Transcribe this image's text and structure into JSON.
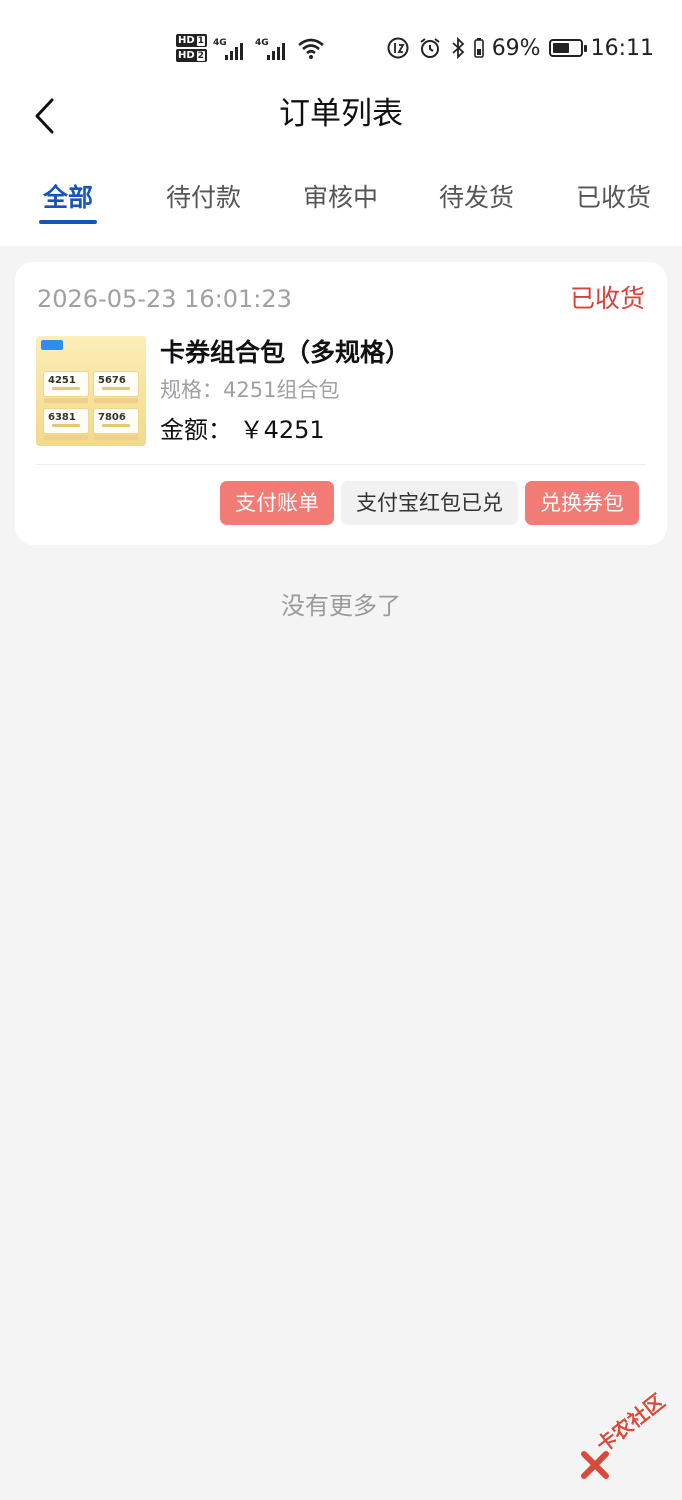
{
  "status_bar": {
    "hd1": "HD",
    "hd1_num": "1",
    "hd2": "HD",
    "hd2_num": "2",
    "net1": "4G",
    "net2": "4G",
    "battery_percent": "69%",
    "battery_level": 0.69,
    "time": "16:11",
    "icons": [
      "signal-icon",
      "wifi-icon",
      "data-saver-icon",
      "alarm-icon",
      "bluetooth-icon",
      "battery-icon"
    ]
  },
  "nav": {
    "title": "订单列表",
    "back_icon": "chevron-left-icon"
  },
  "tabs": {
    "items": [
      {
        "label": "全部",
        "active": true
      },
      {
        "label": "待付款",
        "active": false
      },
      {
        "label": "审核中",
        "active": false
      },
      {
        "label": "待发货",
        "active": false
      },
      {
        "label": "已收货",
        "active": false
      }
    ]
  },
  "orders": [
    {
      "time": "2026-05-23 16:01:23",
      "status": "已收货",
      "goods_name": "卡券组合包（多规格）",
      "spec": "规格：4251组合包",
      "amount": "金额：  ￥4251",
      "thumbnail": {
        "tiles": [
          "4251",
          "5676",
          "6381",
          "7806"
        ]
      },
      "actions": [
        {
          "label": "支付账单",
          "style": "red"
        },
        {
          "label": "支付宝红包已兑",
          "style": "gray"
        },
        {
          "label": "兑换券包",
          "style": "red"
        }
      ]
    }
  ],
  "footer": {
    "no_more": "没有更多了"
  },
  "watermark": {
    "text": "卡农社区"
  },
  "colors": {
    "accent": "#1557b8",
    "status_red": "#d9403a",
    "button_red": "#f27b76",
    "button_gray": "#f1f1f2",
    "background": "#f4f4f5"
  }
}
